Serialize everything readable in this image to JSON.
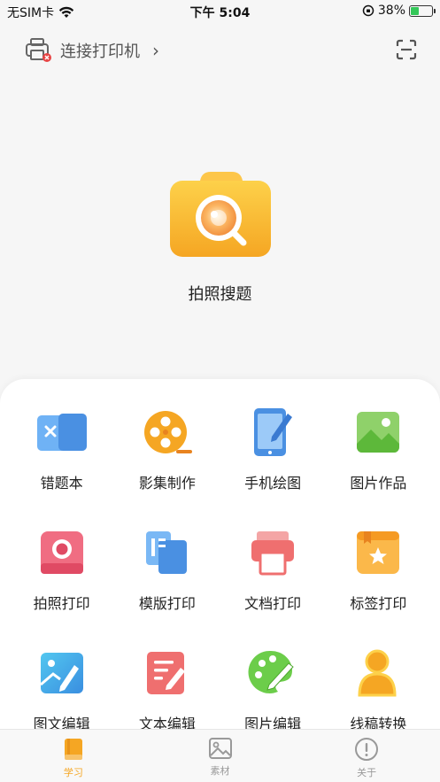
{
  "status_bar": {
    "carrier": "无SIM卡",
    "time": "下午 5:04",
    "battery": "38%",
    "battery_level": 0.38
  },
  "header": {
    "printer_label": "连接打印机",
    "printer_icon": "printer-disconnected-icon",
    "scan_icon": "scan-icon"
  },
  "hero": {
    "label": "拍照搜题",
    "icon": "camera-search-icon"
  },
  "features": [
    {
      "label": "错题本",
      "icon": "error-book-icon"
    },
    {
      "label": "影集制作",
      "icon": "film-reel-icon"
    },
    {
      "label": "手机绘图",
      "icon": "phone-draw-icon"
    },
    {
      "label": "图片作品",
      "icon": "picture-icon"
    },
    {
      "label": "拍照打印",
      "icon": "photo-print-icon"
    },
    {
      "label": "模版打印",
      "icon": "template-print-icon"
    },
    {
      "label": "文档打印",
      "icon": "document-print-icon"
    },
    {
      "label": "标签打印",
      "icon": "label-print-icon"
    },
    {
      "label": "图文编辑",
      "icon": "image-text-edit-icon"
    },
    {
      "label": "文本编辑",
      "icon": "text-edit-icon"
    },
    {
      "label": "图片编辑",
      "icon": "image-edit-icon"
    },
    {
      "label": "线稿转换",
      "icon": "line-art-icon"
    }
  ],
  "tabs": [
    {
      "label": "学习",
      "icon": "book-icon",
      "active": true
    },
    {
      "label": "素材",
      "icon": "image-icon",
      "active": false
    },
    {
      "label": "关于",
      "icon": "info-icon",
      "active": false
    }
  ],
  "colors": {
    "accent": "#f5a623",
    "battery": "#34c759",
    "background": "#f6f6f6"
  }
}
